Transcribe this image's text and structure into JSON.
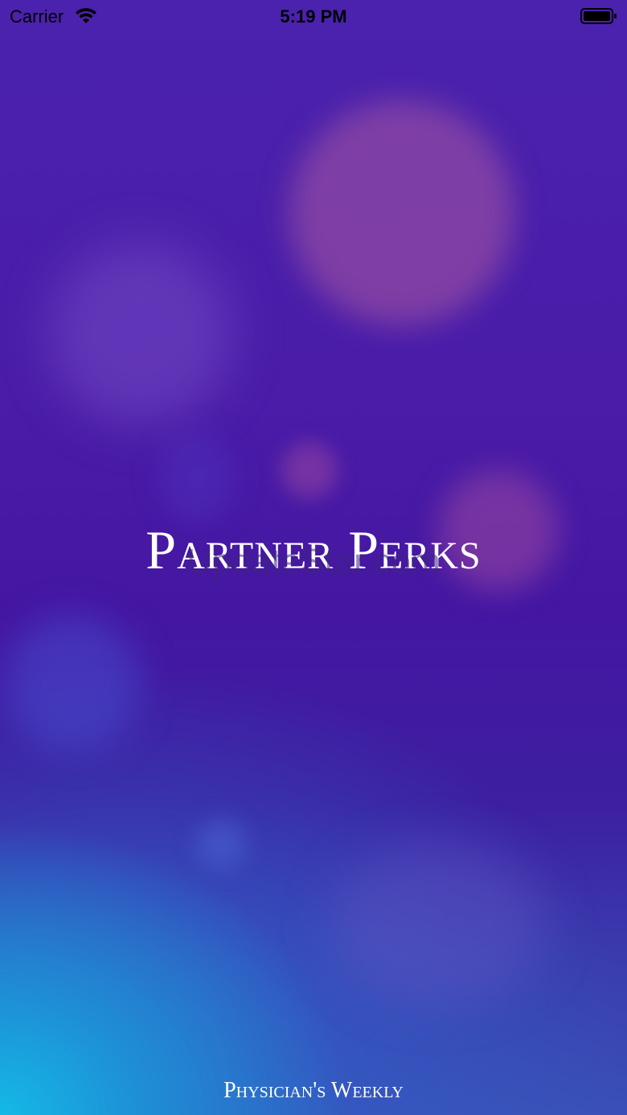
{
  "status_bar": {
    "carrier": "Carrier",
    "time": "5:19 PM",
    "icons": [
      "wifi-icon",
      "battery-icon"
    ]
  },
  "splash": {
    "title": "Partner Perks",
    "watermark": "UpdateStar.com",
    "brand": "Physician's Weekly"
  },
  "colors": {
    "background_top": "#4a22ae",
    "background_bottom_left": "#14b9e6",
    "text": "#ffffff"
  }
}
